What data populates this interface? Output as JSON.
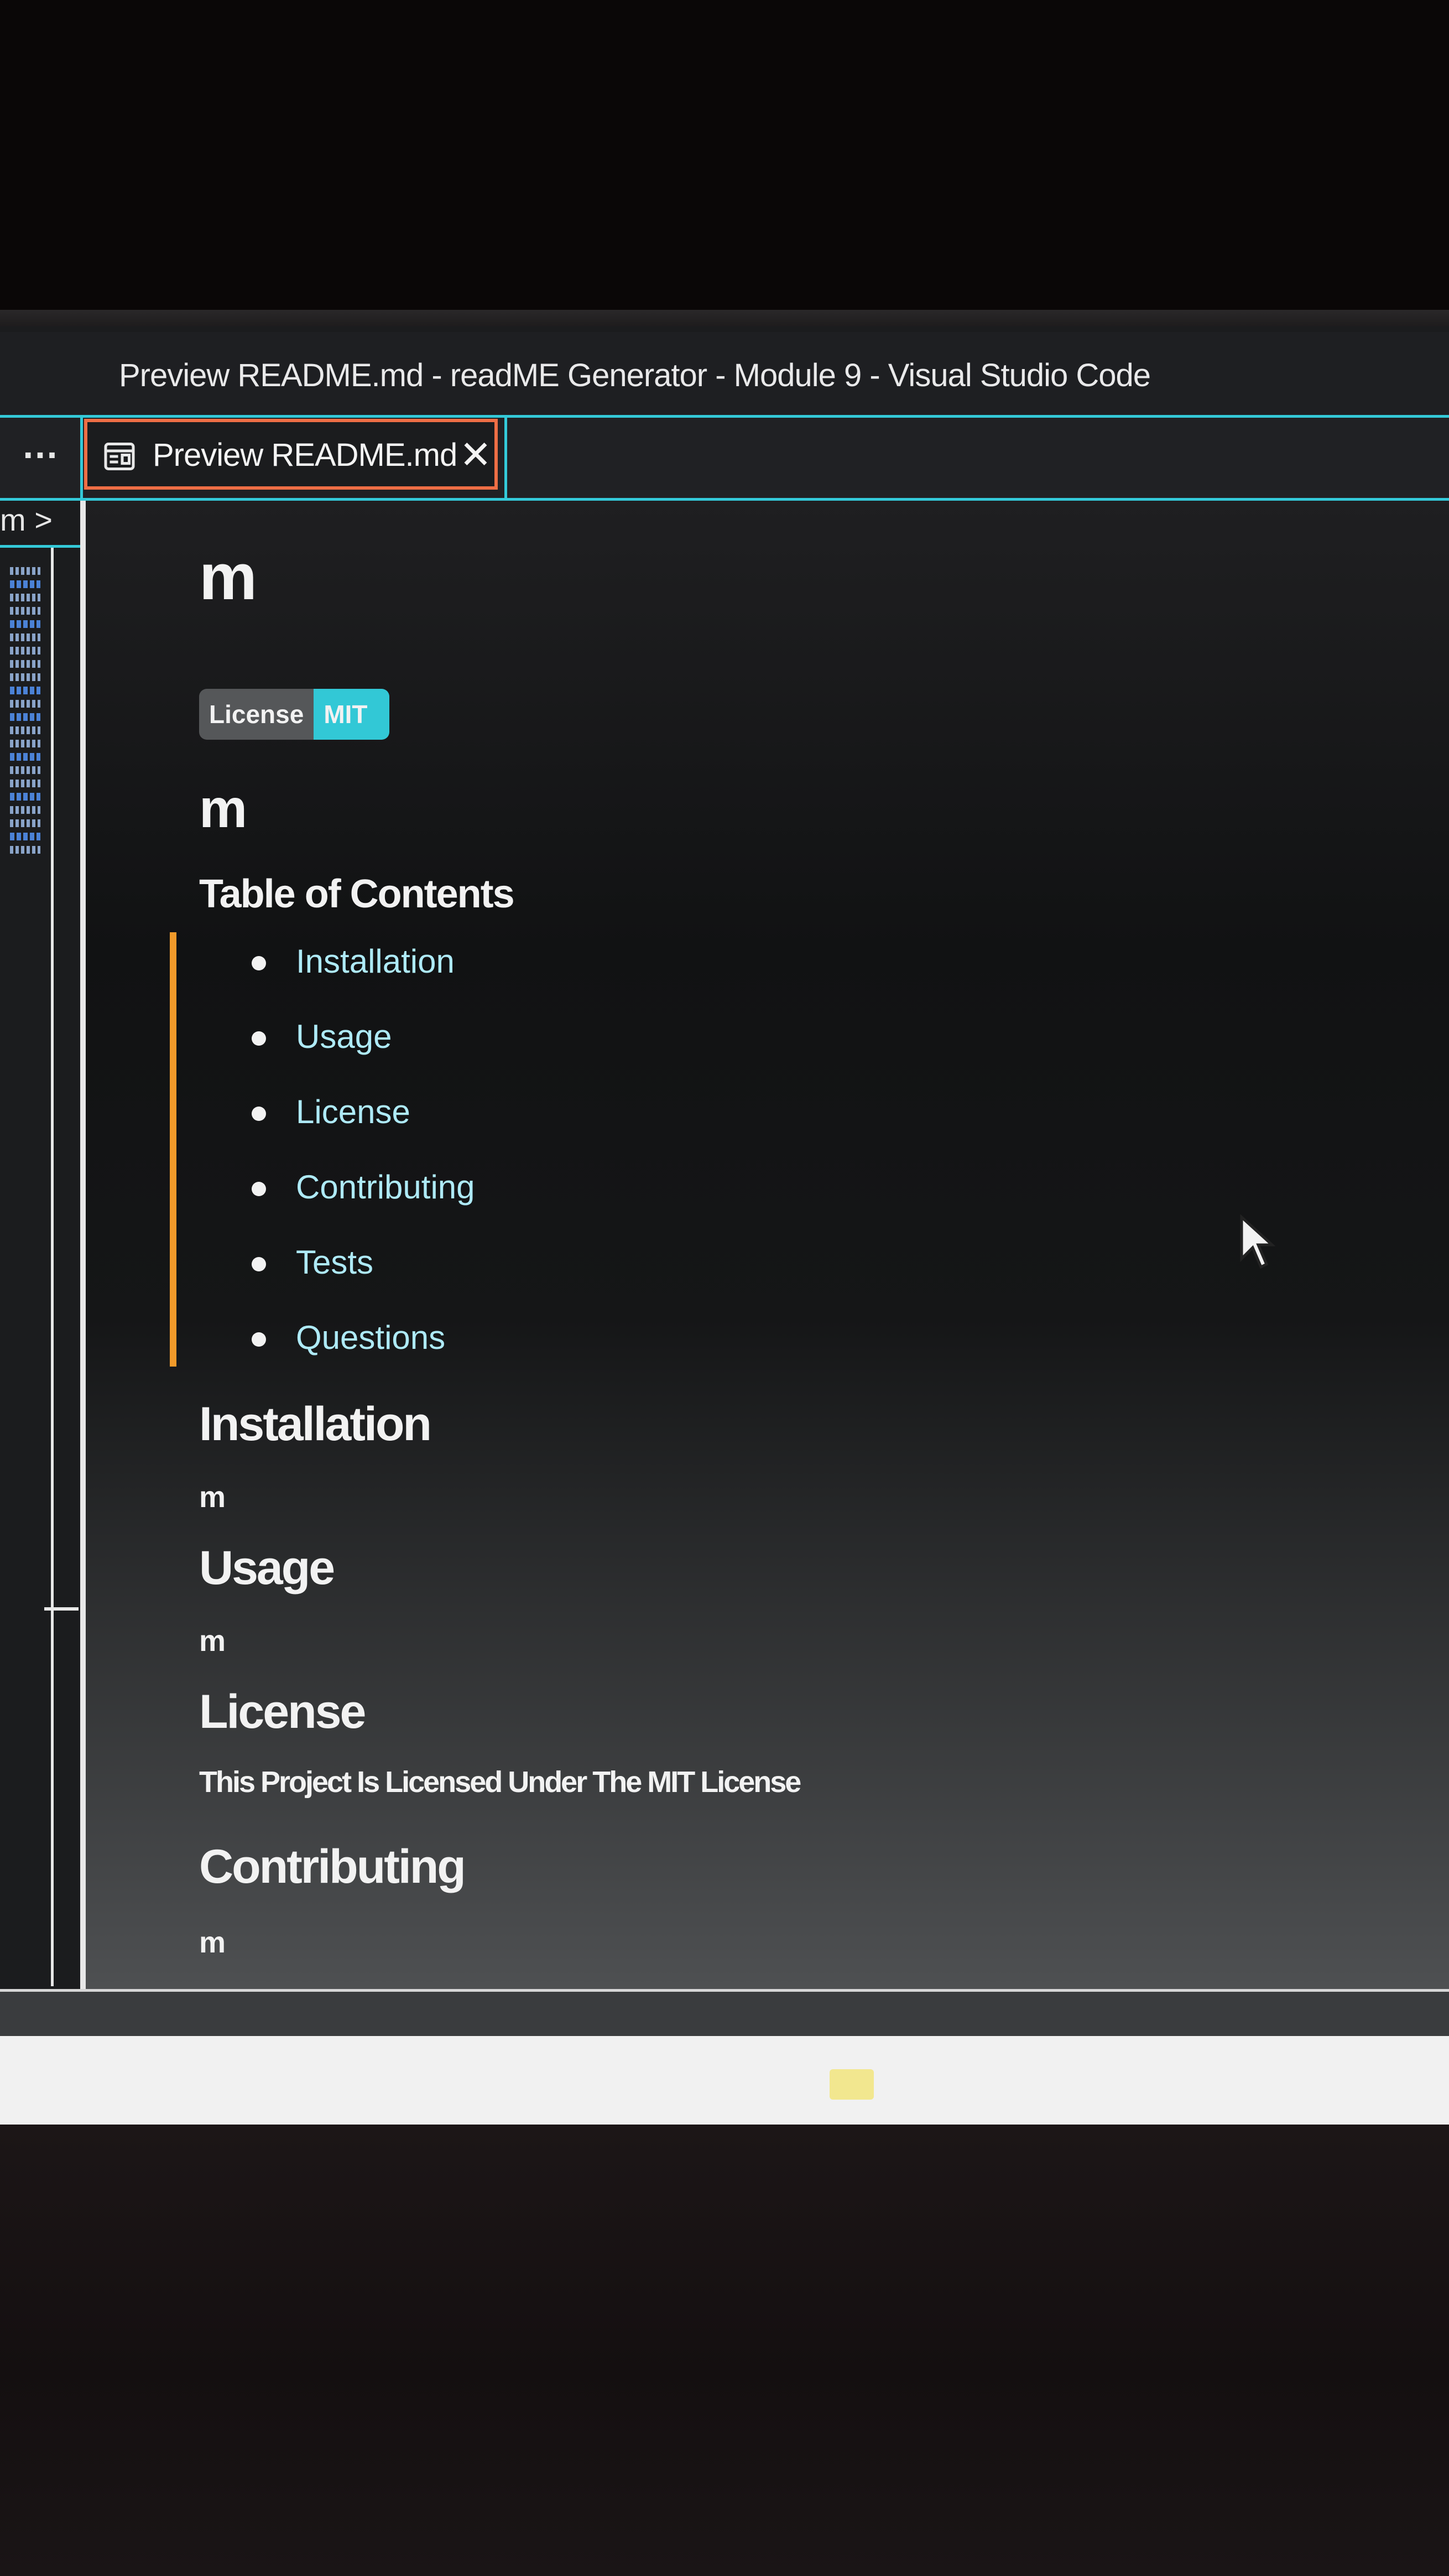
{
  "window": {
    "title": "Preview README.md - readME Generator - Module 9 - Visual Studio Code"
  },
  "tabbar": {
    "more_label": "…",
    "active_tab": {
      "label": "Preview README.md",
      "close_glyph": "✕",
      "icon": "preview-icon"
    }
  },
  "sidebar": {
    "breadcrumb": "m >"
  },
  "preview": {
    "title": "m",
    "badge": {
      "label": "License",
      "value": "MIT",
      "label_color": "#555759",
      "value_color": "#32c8d6"
    },
    "description": "m",
    "toc_heading": "Table of Contents",
    "toc": [
      "Installation",
      "Usage",
      "License",
      "Contributing",
      "Tests",
      "Questions"
    ],
    "sections": {
      "installation": {
        "heading": "Installation",
        "text": "m"
      },
      "usage": {
        "heading": "Usage",
        "text": "m"
      },
      "license": {
        "heading": "License",
        "text": "This Project Is Licensed Under The MIT License"
      },
      "contributing": {
        "heading": "Contributing",
        "text": "m"
      }
    }
  },
  "colors": {
    "accent": "#34c9d8",
    "active_tab_border": "#ee6e45",
    "toc_bar": "#f19a2a",
    "link": "#aeeaf7"
  }
}
